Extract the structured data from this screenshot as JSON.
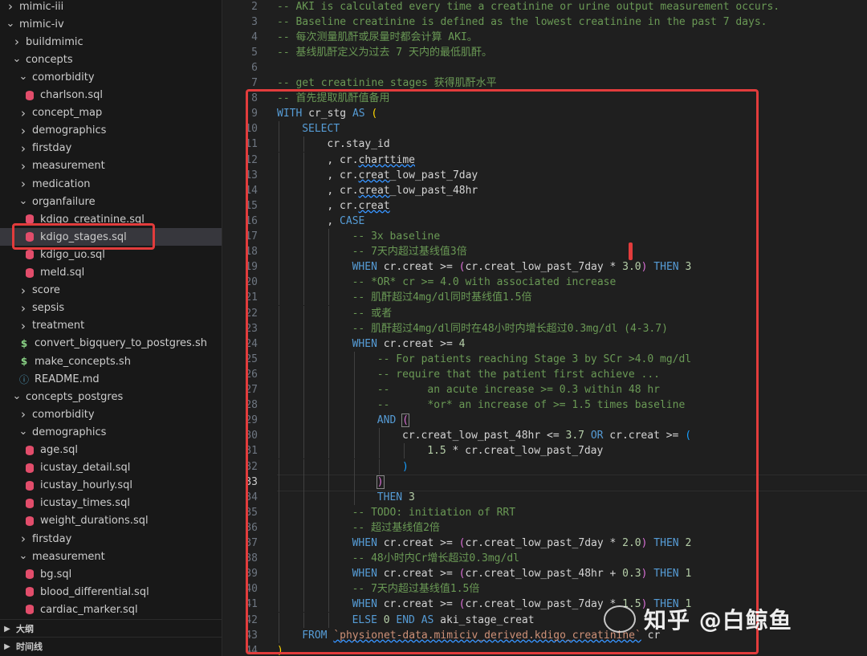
{
  "sidebar": {
    "tree": [
      {
        "label": "mimic-iii",
        "depth": 0,
        "kind": "folder",
        "open": false
      },
      {
        "label": "mimic-iv",
        "depth": 0,
        "kind": "folder",
        "open": true
      },
      {
        "label": "buildmimic",
        "depth": 1,
        "kind": "folder",
        "open": false
      },
      {
        "label": "concepts",
        "depth": 1,
        "kind": "folder",
        "open": true
      },
      {
        "label": "comorbidity",
        "depth": 2,
        "kind": "folder",
        "open": true
      },
      {
        "label": "charlson.sql",
        "depth": 3,
        "kind": "sql"
      },
      {
        "label": "concept_map",
        "depth": 2,
        "kind": "folder",
        "open": false
      },
      {
        "label": "demographics",
        "depth": 2,
        "kind": "folder",
        "open": false
      },
      {
        "label": "firstday",
        "depth": 2,
        "kind": "folder",
        "open": false
      },
      {
        "label": "measurement",
        "depth": 2,
        "kind": "folder",
        "open": false
      },
      {
        "label": "medication",
        "depth": 2,
        "kind": "folder",
        "open": false
      },
      {
        "label": "organfailure",
        "depth": 2,
        "kind": "folder",
        "open": true
      },
      {
        "label": "kdigo_creatinine.sql",
        "depth": 3,
        "kind": "sql"
      },
      {
        "label": "kdigo_stages.sql",
        "depth": 3,
        "kind": "sql",
        "selected": true
      },
      {
        "label": "kdigo_uo.sql",
        "depth": 3,
        "kind": "sql"
      },
      {
        "label": "meld.sql",
        "depth": 3,
        "kind": "sql"
      },
      {
        "label": "score",
        "depth": 2,
        "kind": "folder",
        "open": false
      },
      {
        "label": "sepsis",
        "depth": 2,
        "kind": "folder",
        "open": false
      },
      {
        "label": "treatment",
        "depth": 2,
        "kind": "folder",
        "open": false
      },
      {
        "label": "convert_bigquery_to_postgres.sh",
        "depth": 2,
        "kind": "sh"
      },
      {
        "label": "make_concepts.sh",
        "depth": 2,
        "kind": "sh"
      },
      {
        "label": "README.md",
        "depth": 2,
        "kind": "info"
      },
      {
        "label": "concepts_postgres",
        "depth": 1,
        "kind": "folder",
        "open": true
      },
      {
        "label": "comorbidity",
        "depth": 2,
        "kind": "folder",
        "open": false
      },
      {
        "label": "demographics",
        "depth": 2,
        "kind": "folder",
        "open": true
      },
      {
        "label": "age.sql",
        "depth": 3,
        "kind": "sql"
      },
      {
        "label": "icustay_detail.sql",
        "depth": 3,
        "kind": "sql"
      },
      {
        "label": "icustay_hourly.sql",
        "depth": 3,
        "kind": "sql"
      },
      {
        "label": "icustay_times.sql",
        "depth": 3,
        "kind": "sql"
      },
      {
        "label": "weight_durations.sql",
        "depth": 3,
        "kind": "sql"
      },
      {
        "label": "firstday",
        "depth": 2,
        "kind": "folder",
        "open": false
      },
      {
        "label": "measurement",
        "depth": 2,
        "kind": "folder",
        "open": true
      },
      {
        "label": "bg.sql",
        "depth": 3,
        "kind": "sql"
      },
      {
        "label": "blood_differential.sql",
        "depth": 3,
        "kind": "sql"
      },
      {
        "label": "cardiac_marker.sql",
        "depth": 3,
        "kind": "sql"
      }
    ],
    "panels": [
      {
        "label": "大纲"
      },
      {
        "label": "时间线"
      }
    ]
  },
  "editor": {
    "active_line": 33,
    "lines": [
      {
        "n": "2",
        "indent": 0,
        "t": [
          [
            "cm",
            "-- AKI is calculated every time a creatinine or urine output measurement occurs."
          ]
        ]
      },
      {
        "n": "3",
        "indent": 0,
        "t": [
          [
            "cm",
            "-- Baseline creatinine is defined as the lowest creatinine in the past 7 days."
          ]
        ]
      },
      {
        "n": "4",
        "indent": 0,
        "t": [
          [
            "cm",
            "-- 每次测量肌酐或尿量时都会计算 AKI。"
          ]
        ]
      },
      {
        "n": "5",
        "indent": 0,
        "t": [
          [
            "cm",
            "-- 基线肌酐定义为过去 7 天内的最低肌酐。"
          ]
        ]
      },
      {
        "n": "6",
        "indent": 0,
        "t": []
      },
      {
        "n": "7",
        "indent": 0,
        "t": [
          [
            "cm",
            "-- get creatinine stages 获得肌酐水平"
          ]
        ]
      },
      {
        "n": "8",
        "indent": 0,
        "t": [
          [
            "cm",
            "-- 首先提取肌酐值备用"
          ]
        ]
      },
      {
        "n": "9",
        "indent": 0,
        "t": [
          [
            "kw",
            "WITH"
          ],
          [
            "id",
            " cr_stg "
          ],
          [
            "kw",
            "AS"
          ],
          [
            "id",
            " "
          ],
          [
            "paren-y",
            "("
          ]
        ]
      },
      {
        "n": "10",
        "indent": 1,
        "t": [
          [
            "kw",
            "SELECT"
          ]
        ]
      },
      {
        "n": "11",
        "indent": 2,
        "t": [
          [
            "id",
            "cr.stay_id"
          ]
        ]
      },
      {
        "n": "12",
        "indent": 2,
        "t": [
          [
            "id",
            ", cr."
          ],
          [
            "sq",
            "charttime"
          ]
        ]
      },
      {
        "n": "13",
        "indent": 2,
        "t": [
          [
            "id",
            ", cr."
          ],
          [
            "sq",
            "creat"
          ],
          [
            "id",
            "_low_past_7day"
          ]
        ]
      },
      {
        "n": "14",
        "indent": 2,
        "t": [
          [
            "id",
            ", cr."
          ],
          [
            "sq",
            "creat"
          ],
          [
            "id",
            "_low_past_48hr"
          ]
        ]
      },
      {
        "n": "15",
        "indent": 2,
        "t": [
          [
            "id",
            ", cr."
          ],
          [
            "sq",
            "creat"
          ]
        ]
      },
      {
        "n": "16",
        "indent": 2,
        "t": [
          [
            "id",
            ", "
          ],
          [
            "kw",
            "CASE"
          ]
        ]
      },
      {
        "n": "17",
        "indent": 3,
        "t": [
          [
            "cm",
            "-- 3x baseline"
          ]
        ]
      },
      {
        "n": "18",
        "indent": 3,
        "t": [
          [
            "cm",
            "-- 7天内超过基线值3倍"
          ]
        ]
      },
      {
        "n": "19",
        "indent": 3,
        "t": [
          [
            "kw",
            "WHEN"
          ],
          [
            "id",
            " cr.creat >= "
          ],
          [
            "paren-p",
            "("
          ],
          [
            "id",
            "cr.creat_low_past_7day * "
          ],
          [
            "num",
            "3.0"
          ],
          [
            "paren-p",
            ")"
          ],
          [
            "id",
            " "
          ],
          [
            "kw",
            "THEN"
          ],
          [
            "id",
            " "
          ],
          [
            "num",
            "3"
          ]
        ]
      },
      {
        "n": "20",
        "indent": 3,
        "t": [
          [
            "cm",
            "-- *OR* cr >= 4.0 with associated increase"
          ]
        ]
      },
      {
        "n": "21",
        "indent": 3,
        "t": [
          [
            "cm",
            "-- 肌酐超过4mg/dl同时基线值1.5倍"
          ]
        ]
      },
      {
        "n": "22",
        "indent": 3,
        "t": [
          [
            "cm",
            "-- 或者"
          ]
        ]
      },
      {
        "n": "23",
        "indent": 3,
        "t": [
          [
            "cm",
            "-- 肌酐超过4mg/dl同时在48小时内增长超过0.3mg/dl (4-3.7)"
          ]
        ]
      },
      {
        "n": "24",
        "indent": 3,
        "t": [
          [
            "kw",
            "WHEN"
          ],
          [
            "id",
            " cr.creat >= "
          ],
          [
            "num",
            "4"
          ]
        ]
      },
      {
        "n": "25",
        "indent": 4,
        "t": [
          [
            "cm",
            "-- For patients reaching Stage 3 by SCr >4.0 mg/dl"
          ]
        ]
      },
      {
        "n": "26",
        "indent": 4,
        "t": [
          [
            "cm",
            "-- require that the patient first achieve ..."
          ]
        ]
      },
      {
        "n": "27",
        "indent": 4,
        "t": [
          [
            "cm",
            "--      an acute increase >= 0.3 within 48 hr"
          ]
        ]
      },
      {
        "n": "28",
        "indent": 4,
        "t": [
          [
            "cm",
            "--      *or* an increase of >= 1.5 times baseline"
          ]
        ]
      },
      {
        "n": "29",
        "indent": 4,
        "t": [
          [
            "kw",
            "AND"
          ],
          [
            "id",
            " "
          ],
          [
            "paren-p-box",
            "("
          ]
        ]
      },
      {
        "n": "30",
        "indent": 5,
        "t": [
          [
            "id",
            "cr.creat_low_past_48hr <= "
          ],
          [
            "num",
            "3.7"
          ],
          [
            "id",
            " "
          ],
          [
            "kw",
            "OR"
          ],
          [
            "id",
            " cr.creat >= "
          ],
          [
            "paren-b",
            "("
          ]
        ]
      },
      {
        "n": "31",
        "indent": 6,
        "t": [
          [
            "num",
            "1.5"
          ],
          [
            "id",
            " * cr.creat_low_past_7day"
          ]
        ]
      },
      {
        "n": "32",
        "indent": 5,
        "t": [
          [
            "paren-b",
            ")"
          ]
        ]
      },
      {
        "n": "33",
        "indent": 4,
        "t": [
          [
            "paren-p-box",
            ")"
          ]
        ]
      },
      {
        "n": "34",
        "indent": 4,
        "t": [
          [
            "kw",
            "THEN"
          ],
          [
            "id",
            " "
          ],
          [
            "num",
            "3"
          ]
        ]
      },
      {
        "n": "35",
        "indent": 3,
        "t": [
          [
            "cm",
            "-- TODO: initiation of RRT"
          ]
        ]
      },
      {
        "n": "36",
        "indent": 3,
        "t": [
          [
            "cm",
            "-- 超过基线值2倍"
          ]
        ]
      },
      {
        "n": "37",
        "indent": 3,
        "t": [
          [
            "kw",
            "WHEN"
          ],
          [
            "id",
            " cr.creat >= "
          ],
          [
            "paren-p",
            "("
          ],
          [
            "id",
            "cr.creat_low_past_7day * "
          ],
          [
            "num",
            "2.0"
          ],
          [
            "paren-p",
            ")"
          ],
          [
            "id",
            " "
          ],
          [
            "kw",
            "THEN"
          ],
          [
            "id",
            " "
          ],
          [
            "num",
            "2"
          ]
        ]
      },
      {
        "n": "38",
        "indent": 3,
        "t": [
          [
            "cm",
            "-- 48小时内Cr增长超过0.3mg/dl"
          ]
        ]
      },
      {
        "n": "39",
        "indent": 3,
        "t": [
          [
            "kw",
            "WHEN"
          ],
          [
            "id",
            " cr.creat >= "
          ],
          [
            "paren-p",
            "("
          ],
          [
            "id",
            "cr.creat_low_past_48hr + "
          ],
          [
            "num",
            "0.3"
          ],
          [
            "paren-p",
            ")"
          ],
          [
            "id",
            " "
          ],
          [
            "kw",
            "THEN"
          ],
          [
            "id",
            " "
          ],
          [
            "num",
            "1"
          ]
        ]
      },
      {
        "n": "40",
        "indent": 3,
        "t": [
          [
            "cm",
            "-- 7天内超过基线值1.5倍"
          ]
        ]
      },
      {
        "n": "41",
        "indent": 3,
        "t": [
          [
            "kw",
            "WHEN"
          ],
          [
            "id",
            " cr.creat >= "
          ],
          [
            "paren-p",
            "("
          ],
          [
            "id",
            "cr.creat_low_past_7day * "
          ],
          [
            "num",
            "1.5"
          ],
          [
            "paren-p",
            ")"
          ],
          [
            "id",
            " "
          ],
          [
            "kw",
            "THEN"
          ],
          [
            "id",
            " "
          ],
          [
            "num",
            "1"
          ]
        ]
      },
      {
        "n": "42",
        "indent": 3,
        "t": [
          [
            "kw",
            "ELSE"
          ],
          [
            "id",
            " "
          ],
          [
            "num",
            "0"
          ],
          [
            "id",
            " "
          ],
          [
            "kw",
            "END"
          ],
          [
            "id",
            " "
          ],
          [
            "kw",
            "AS"
          ],
          [
            "id",
            " aki_stage_creat"
          ]
        ]
      },
      {
        "n": "43",
        "indent": 1,
        "t": [
          [
            "kw",
            "FROM"
          ],
          [
            "id",
            " "
          ],
          [
            "str-sq",
            "`physionet-data.mimiciv_derived.kdigo_creatinine`"
          ],
          [
            "id",
            " cr"
          ]
        ]
      },
      {
        "n": "44",
        "indent": 0,
        "t": [
          [
            "paren-y",
            ")"
          ]
        ]
      }
    ]
  },
  "watermark": {
    "text": "知乎 @白鲸鱼",
    "icon": "wechat-icon"
  },
  "colors": {
    "highlight": "#e23c3c",
    "keyword": "#569cd6",
    "comment": "#6a9955",
    "number": "#b5cea8",
    "string": "#ce9178",
    "sql_icon": "#e24d6b",
    "shell_icon": "#89d185"
  }
}
